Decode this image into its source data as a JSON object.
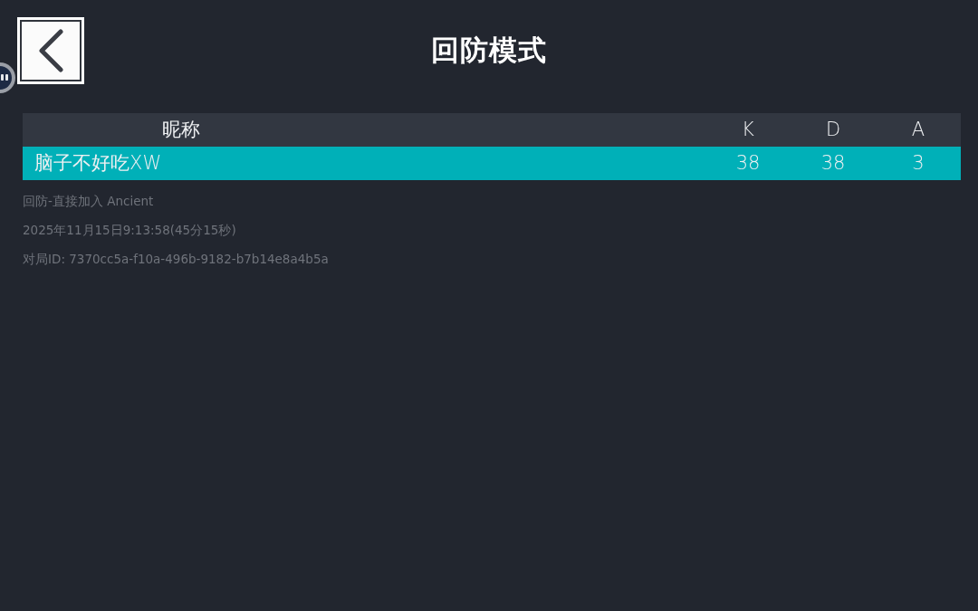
{
  "header": {
    "title": "回防模式"
  },
  "table": {
    "columns": [
      "昵称",
      "K",
      "D",
      "A"
    ],
    "rows": [
      {
        "cells": [
          "脑子不好吃XW",
          "38",
          "38",
          "3"
        ],
        "selected": true
      }
    ]
  },
  "match_info": [
    "回防-直接加入 Ancient",
    "2025年11月15日9:13:58(45分15秒)",
    "对局ID: 7370cc5a-f10a-496b-9182-b7b14e8a4b5a"
  ]
}
